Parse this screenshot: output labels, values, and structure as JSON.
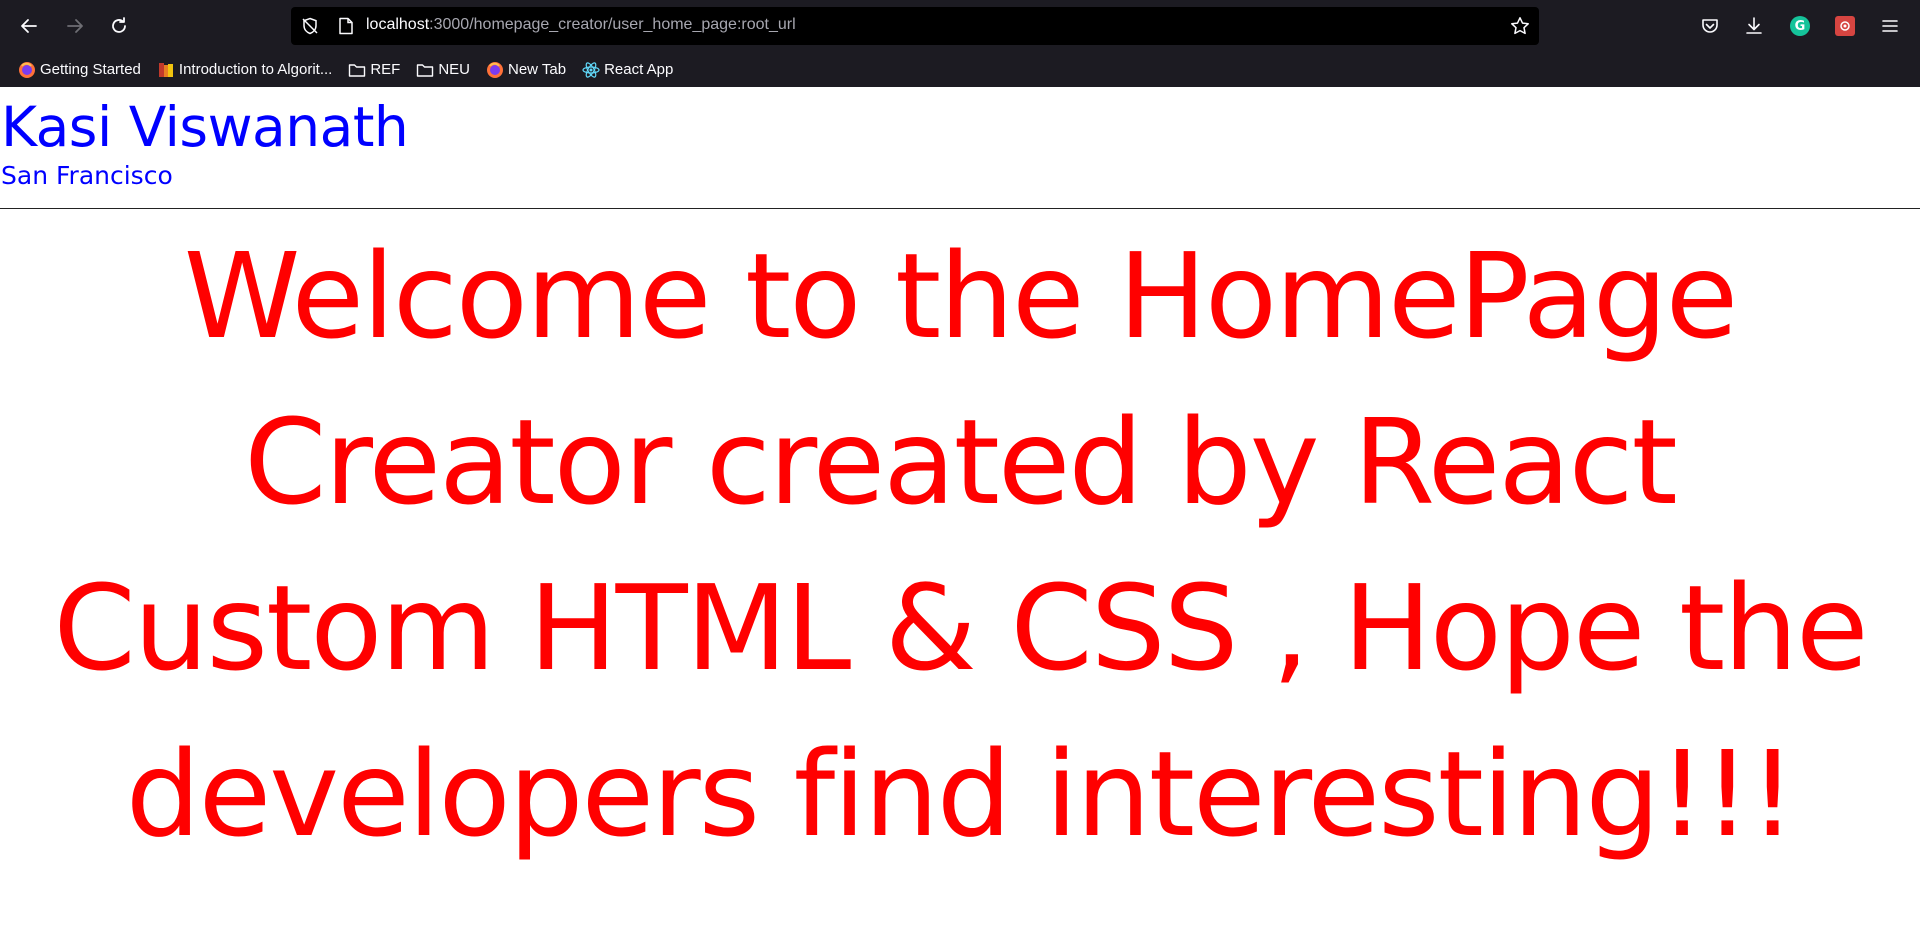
{
  "browser": {
    "url_host": "localhost",
    "url_rest": ":3000/homepage_creator/user_home_page:root_url",
    "toolbar_icons": [
      "back-arrow-icon",
      "forward-arrow-icon",
      "reload-icon",
      "tracking-shield-icon",
      "page-icon",
      "star-icon",
      "pocket-icon",
      "download-icon",
      "grammarly-icon",
      "extension-icon",
      "hamburger-menu-icon"
    ],
    "grammarly_letter": "G",
    "bookmarks": [
      {
        "label": "Getting Started",
        "icon": "firefox-icon"
      },
      {
        "label": "Introduction to Algorit...",
        "icon": "book-icon"
      },
      {
        "label": "REF",
        "icon": "folder-icon"
      },
      {
        "label": "NEU",
        "icon": "folder-icon"
      },
      {
        "label": "New Tab",
        "icon": "firefox-icon"
      },
      {
        "label": "React App",
        "icon": "react-icon"
      }
    ]
  },
  "page": {
    "user_name": "Kasi Viswanath",
    "user_city": "San Francisco",
    "welcome_message": "Welcome to the HomePage Creator created by React Custom HTML & CSS , Hope the developers find interesting!!!",
    "colors": {
      "name_color": "#0000ff",
      "message_color": "#ff0000"
    }
  }
}
